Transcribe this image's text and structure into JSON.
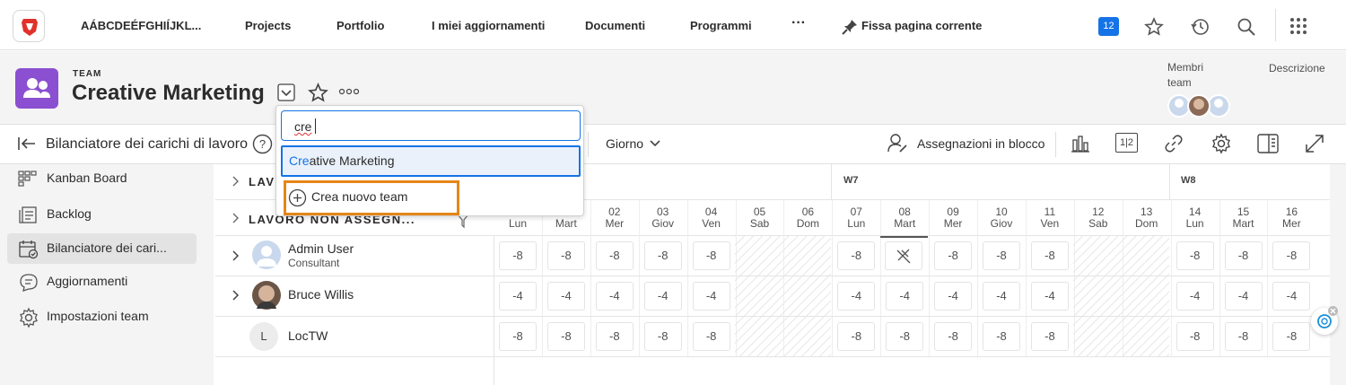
{
  "topnav": {
    "workspace": "AÁBCDEÉFGHIÍJKL...",
    "items": [
      "Projects",
      "Portfolio",
      "I miei aggiornamenti",
      "Documenti",
      "Programmi"
    ],
    "more": "···",
    "pin_label": "Fissa pagina corrente",
    "notifications_count": "12"
  },
  "header": {
    "type_label": "TEAM",
    "title": "Creative Marketing",
    "members_label_1": "Membri",
    "members_label_2": "team",
    "description_label": "Descrizione"
  },
  "toolbar": {
    "title": "Bilanciatore dei carichi di lavoro",
    "view": "Giorno",
    "bulk": "Assegnazioni in blocco",
    "ratio": "1|2"
  },
  "dropdown": {
    "query": "cre",
    "result_match": "Cre",
    "result_rest": "ative Marketing",
    "create_label": "Crea nuovo team"
  },
  "sidebar": {
    "items": [
      {
        "label": "Kanban Board",
        "icon": "kanban-icon"
      },
      {
        "label": "Backlog",
        "icon": "backlog-icon"
      },
      {
        "label": "Bilanciatore dei cari...",
        "icon": "calendar-icon"
      },
      {
        "label": "Aggiornamenti",
        "icon": "comment-icon"
      },
      {
        "label": "Impostazioni team",
        "icon": "gear-icon"
      }
    ]
  },
  "grid": {
    "groups": {
      "lavoro": "LAVO",
      "non_assegnato": "LAVORO NON ASSEGN..."
    },
    "weeks": [
      "W7",
      "W8"
    ],
    "days": [
      {
        "num": "",
        "name": "Lun"
      },
      {
        "num": "",
        "name": "Mart"
      },
      {
        "num": "02",
        "name": "Mer"
      },
      {
        "num": "03",
        "name": "Giov"
      },
      {
        "num": "04",
        "name": "Ven"
      },
      {
        "num": "05",
        "name": "Sab"
      },
      {
        "num": "06",
        "name": "Dom"
      },
      {
        "num": "07",
        "name": "Lun"
      },
      {
        "num": "08",
        "name": "Mart"
      },
      {
        "num": "09",
        "name": "Mer"
      },
      {
        "num": "10",
        "name": "Giov"
      },
      {
        "num": "11",
        "name": "Ven"
      },
      {
        "num": "12",
        "name": "Sab"
      },
      {
        "num": "13",
        "name": "Dom"
      },
      {
        "num": "14",
        "name": "Lun"
      },
      {
        "num": "15",
        "name": "Mart"
      },
      {
        "num": "16",
        "name": "Mer"
      }
    ],
    "users": [
      {
        "name": "Admin User",
        "role": "Consultant",
        "initial": "",
        "values": [
          "-8",
          "-8",
          "-8",
          "-8",
          "-8",
          "",
          "",
          "-8",
          "",
          "-8",
          "-8",
          "-8",
          "",
          "",
          "-8",
          "-8",
          "-8"
        ]
      },
      {
        "name": "Bruce Willis",
        "role": "",
        "initial": "",
        "values": [
          "-4",
          "-4",
          "-4",
          "-4",
          "-4",
          "",
          "",
          "-4",
          "-4",
          "-4",
          "-4",
          "-4",
          "",
          "",
          "-4",
          "-4",
          "-4"
        ]
      },
      {
        "name": "LocTW",
        "role": "",
        "initial": "L",
        "values": [
          "-8",
          "-8",
          "-8",
          "-8",
          "-8",
          "",
          "",
          "-8",
          "-8",
          "-8",
          "-8",
          "-8",
          "",
          "",
          "-8",
          "-8",
          "-8"
        ]
      }
    ]
  },
  "colors": {
    "accent": "#1473e6",
    "team_icon": "#8b4fd1",
    "highlight": "#e68619"
  }
}
